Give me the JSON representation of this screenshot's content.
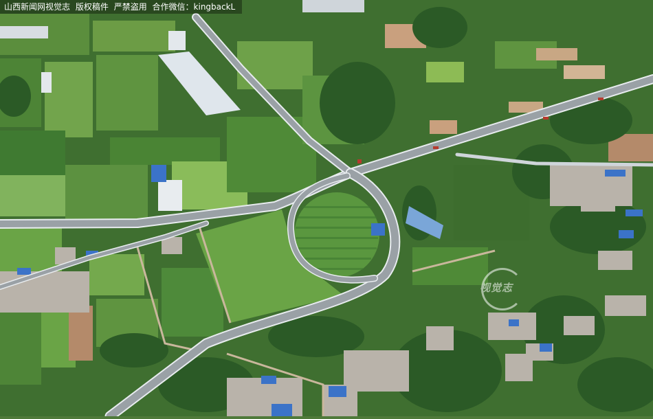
{
  "caption": {
    "source": "山西新闻网视觉志",
    "copyright": "版权稿件",
    "warning": "严禁盗用",
    "contact": "合作微信：kingbackL"
  },
  "watermark": {
    "text": "视觉志"
  },
  "colors": {
    "field_dark": "#2f6b2c",
    "field_mid": "#4f8c3a",
    "field_light": "#7fae55",
    "grass": "#6aa446",
    "road": "#9aa1a6",
    "road_edge": "#e8ecef",
    "greenhouse": "#dfe6ec",
    "village_roof": "#b9b3aa",
    "blue_roof": "#3b73c8",
    "soil": "#b48a6a"
  }
}
